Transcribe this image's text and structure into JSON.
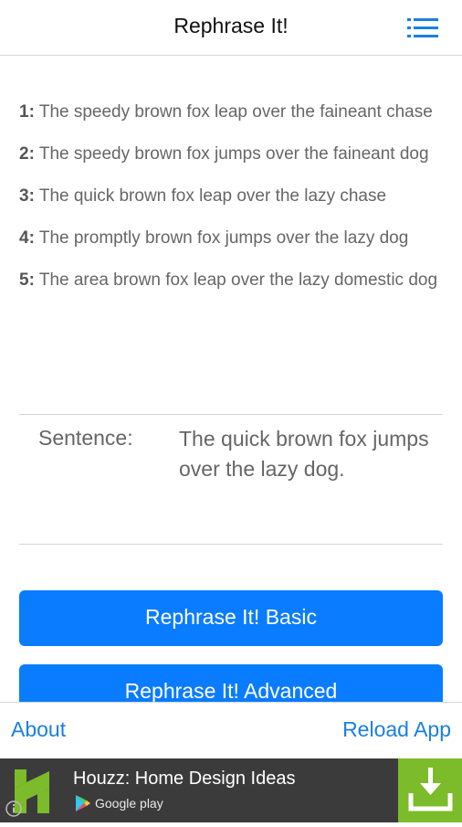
{
  "app_bar": {
    "title": "Rephrase It!",
    "menu_icon": "hamburger-menu-icon",
    "accent_color": "#1a7fe0"
  },
  "results": [
    {
      "num": "1:",
      "text": " The speedy brown fox leap over the faineant chase"
    },
    {
      "num": "2:",
      "text": " The speedy brown fox jumps over the faineant dog"
    },
    {
      "num": "3:",
      "text": " The quick brown fox leap over the lazy chase"
    },
    {
      "num": "4:",
      "text": " The promptly brown fox jumps over the lazy dog"
    },
    {
      "num": "5:",
      "text": " The area brown fox leap over the lazy domestic dog"
    }
  ],
  "sentence": {
    "label": "Sentence:",
    "value": "The quick brown fox jumps over the lazy dog."
  },
  "buttons": {
    "basic_label": "Rephrase It! Basic",
    "advanced_label": "Rephrase It! Advanced",
    "color": "#0a7cff"
  },
  "bottom_nav": {
    "about_label": "About",
    "reload_label": "Reload App"
  },
  "ad": {
    "title": "Houzz: Home Design Ideas",
    "store_label": "Google play",
    "logo_icon": "houzz-logo-icon",
    "download_icon": "download-icon",
    "info_icon": "info-icon",
    "background": "#3b3b3b",
    "download_bg": "#7cbb2a"
  }
}
